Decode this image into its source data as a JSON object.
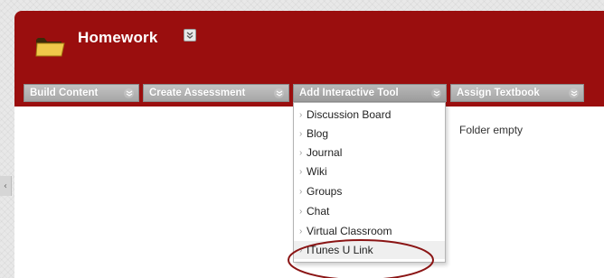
{
  "page": {
    "title": "Homework",
    "folder_empty": "Folder empty"
  },
  "toolbar": {
    "buttons": [
      {
        "label": "Build Content"
      },
      {
        "label": "Create Assessment"
      },
      {
        "label": "Add Interactive Tool"
      },
      {
        "label": "Assign Textbook"
      }
    ]
  },
  "dropdown": {
    "items": [
      {
        "label": "Discussion Board"
      },
      {
        "label": "Blog"
      },
      {
        "label": "Journal"
      },
      {
        "label": "Wiki"
      },
      {
        "label": "Groups"
      },
      {
        "label": "Chat"
      },
      {
        "label": "Virtual Classroom"
      },
      {
        "label": "ITunes U Link",
        "highlighted": true
      }
    ]
  },
  "colors": {
    "header": "#9a0e0e",
    "toolbar_button": "#b0b0b0",
    "annotation_ellipse": "#8a1414"
  },
  "icons": {
    "folder": "folder-icon",
    "menu": "double-chevron-down-icon",
    "item_arrow": "chevron-right-icon",
    "collapse": "chevron-left-icon"
  }
}
